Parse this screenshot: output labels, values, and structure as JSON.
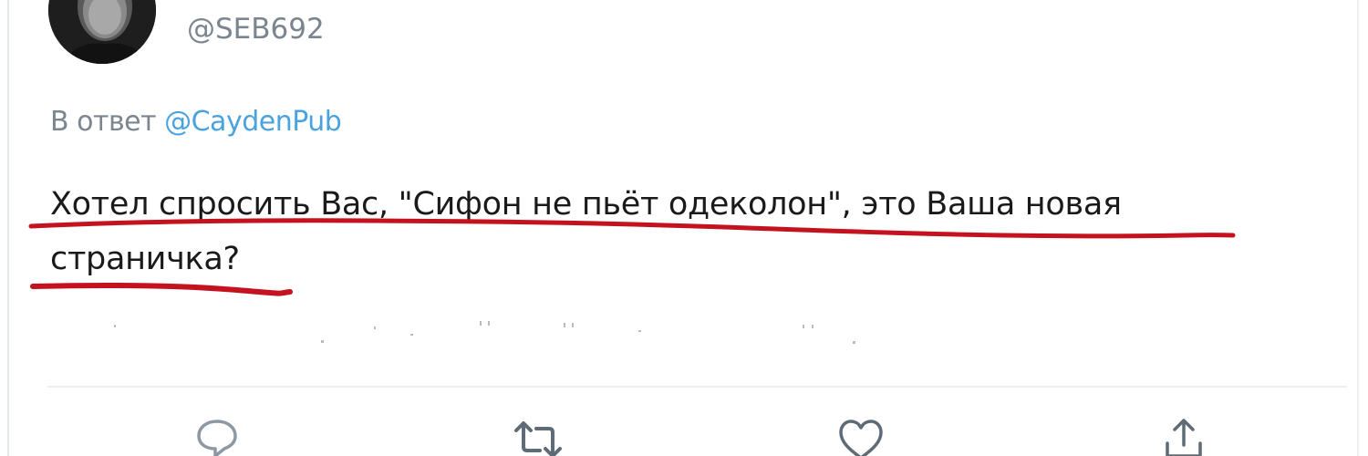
{
  "author": {
    "handle": "@SEB692",
    "avatar_icon": "avatar-photo"
  },
  "reply": {
    "prefix": "В ответ",
    "mention": "@CaydenPub"
  },
  "tweet": {
    "text": "Хотел спросить Вас, \"Сифон не пьёт одеколон\", это Ваша новая страничка?"
  },
  "actions": [
    {
      "name": "reply",
      "icon": "comment-icon"
    },
    {
      "name": "retweet",
      "icon": "retweet-icon"
    },
    {
      "name": "like",
      "icon": "heart-icon"
    },
    {
      "name": "share",
      "icon": "share-icon"
    }
  ],
  "colors": {
    "text": "#1a1a1a",
    "muted": "#7a858f",
    "mention": "#4aa3df",
    "icon": "#657786",
    "annotation_underline": "#c4121f"
  }
}
